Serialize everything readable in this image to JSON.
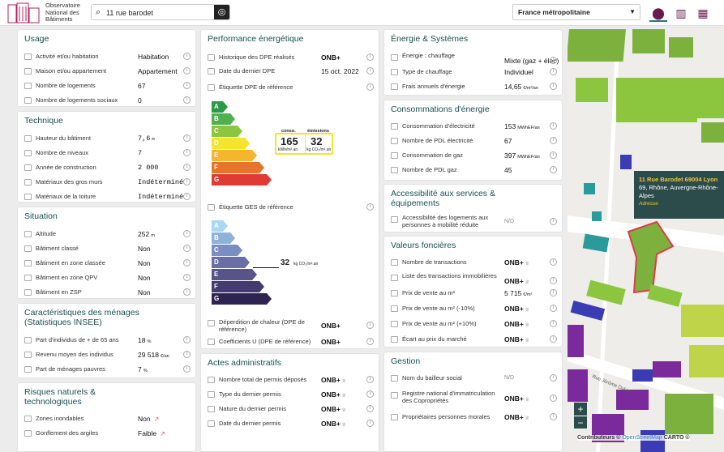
{
  "header": {
    "logo_line1": "Observatoire",
    "logo_line2": "National des",
    "logo_line3": "Bâtiments",
    "search_value": "11 rue barodet",
    "region": "France métropolitaine"
  },
  "usage": {
    "title": "Usage",
    "rows": [
      {
        "label": "Activité et/ou habitation",
        "value": "Habitation"
      },
      {
        "label": "Maison et/ou appartement",
        "value": "Appartement"
      },
      {
        "label": "Nombre de logements",
        "value": "67"
      },
      {
        "label": "Nombre de logements sociaux",
        "value": "0"
      }
    ]
  },
  "technique": {
    "title": "Technique",
    "rows": [
      {
        "label": "Hauteur du bâtiment",
        "value": "7,6",
        "unit": "m"
      },
      {
        "label": "Nombre de niveaux",
        "value": "7"
      },
      {
        "label": "Année de construction",
        "value": "2 000"
      },
      {
        "label": "Matériaux des gros murs",
        "value": "Indéterminé"
      },
      {
        "label": "Matériaux de la toiture",
        "value": "Indéterminé"
      }
    ]
  },
  "situation": {
    "title": "Situation",
    "rows": [
      {
        "label": "Altitude",
        "value": "252",
        "unit": "m"
      },
      {
        "label": "Bâtiment classé",
        "value": "Non"
      },
      {
        "label": "Bâtiment en zone classée",
        "value": "Non"
      },
      {
        "label": "Bâtiment en zone QPV",
        "value": "Non"
      },
      {
        "label": "Bâtiment en ZSP",
        "value": "Non"
      }
    ]
  },
  "menages": {
    "title": "Caractéristiques des ménages (Statistiques INSEE)",
    "rows": [
      {
        "label": "Part d'individus de + de 65 ans",
        "value": "18",
        "unit": "%"
      },
      {
        "label": "Revenu moyen des individus",
        "value": "29 518",
        "unit": "€/an"
      },
      {
        "label": "Part de ménages pauvres",
        "value": "7",
        "unit": "%"
      }
    ]
  },
  "risques": {
    "title": "Risques naturels & technologiques",
    "rows": [
      {
        "label": "Zones inondables",
        "value": "Non"
      },
      {
        "label": "Gonflement des argiles",
        "value": "Faible"
      }
    ]
  },
  "perf": {
    "title": "Performance énergétique",
    "historique_label": "Historique des DPE réalisés",
    "onb": "ONB+",
    "date_label": "Date du dernier DPE",
    "date_value": "15 oct. 2022",
    "dpe_label": "Étiquette DPE de référence",
    "conso_label": "conso.",
    "emis_label": "émissions",
    "conso_value": "165",
    "conso_unit": "kWh/m².an",
    "emis_value": "32",
    "emis_unit": "kg CO₂/m².an",
    "ges_label": "Étiquette GES de référence",
    "ges_value": "32",
    "ges_unit": "kg CO₂/m².an",
    "deperd_label": "Déperdition de chaleur (DPE de référence)",
    "coef_label": "Coefficients U (DPE de référence)",
    "letters": [
      "A",
      "B",
      "C",
      "D",
      "E",
      "F",
      "G"
    ],
    "dpe_colors": [
      "#2a9a48",
      "#4fb14e",
      "#8cc63f",
      "#f2e52b",
      "#f5b52e",
      "#e8742a",
      "#e03a34"
    ],
    "ges_colors": [
      "#a9d8f2",
      "#8fb2d8",
      "#7a8fc1",
      "#6a6ea6",
      "#58548a",
      "#443b6e",
      "#2d2451"
    ]
  },
  "actes": {
    "title": "Actes administratifs",
    "rows": [
      {
        "label": "Nombre total de permis déposés"
      },
      {
        "label": "Type du dernier permis"
      },
      {
        "label": "Nature du dernier permis"
      },
      {
        "label": "Date du dernier permis"
      }
    ]
  },
  "energie": {
    "title": "Énergie & Systèmes",
    "rows": [
      {
        "label": "Énergie : chauffage",
        "value": "Mixte (gaz + élec)"
      },
      {
        "label": "Type de chauffage",
        "value": "Individuel"
      },
      {
        "label": "Frais annuels d'énergie",
        "value": "14,65",
        "unit": "€/m²/an"
      }
    ]
  },
  "conso": {
    "title": "Consommations d'énergie",
    "rows": [
      {
        "label": "Consommation d'électricité",
        "value": "153",
        "unit": "MWhEF/an"
      },
      {
        "label": "Nombre de PDL électricité",
        "value": "67"
      },
      {
        "label": "Consommation de gaz",
        "value": "397",
        "unit": "MWhEF/an"
      },
      {
        "label": "Nombre de PDL gaz",
        "value": "45"
      }
    ]
  },
  "access": {
    "title": "Accessibilité aux services & équipements",
    "row_label": "Accessibilité des logements aux personnes à mobilité réduite",
    "row_value": "N/D"
  },
  "foncier": {
    "title": "Valeurs foncières",
    "rows": [
      {
        "label": "Nombre de transactions",
        "value": "ONB+"
      },
      {
        "label": "Liste des transactions immobilières",
        "value": "ONB+"
      },
      {
        "label": "Prix de vente au m²",
        "value": "5 715",
        "unit": "€/m²"
      },
      {
        "label": "Prix de vente au m² (-10%)",
        "value": "ONB+"
      },
      {
        "label": "Prix de vente au m² (+10%)",
        "value": "ONB+"
      },
      {
        "label": "Écart au prix du marché",
        "value": "ONB+"
      }
    ]
  },
  "gestion": {
    "title": "Gestion",
    "rows": [
      {
        "label": "Nom du bailleur social",
        "value": "N/D"
      },
      {
        "label": "Registre national d'immatriculation des Copropriétés",
        "value": "ONB+"
      },
      {
        "label": "Propriétaires personnes morales",
        "value": "ONB+"
      }
    ]
  },
  "map": {
    "popup_title": "11 Rue Barodet 69004 Lyon",
    "popup_line2": "69, Rhône, Auvergne-Rhône-",
    "popup_line3": "Alpes",
    "popup_type": "Adresse",
    "street1": "Rue Jérôme Dulaar",
    "attr_text": "Contributeurs ©",
    "attr_osm": "OpenStreetMap",
    "attr_carto": "CARTO ©",
    "zoom_in": "+",
    "zoom_out": "−"
  },
  "icons": [
    "search-icon",
    "locate-icon",
    "map-marker-icon",
    "bar-chart-icon",
    "building-icon",
    "info-icon",
    "external-link-icon",
    "crown-icon"
  ]
}
